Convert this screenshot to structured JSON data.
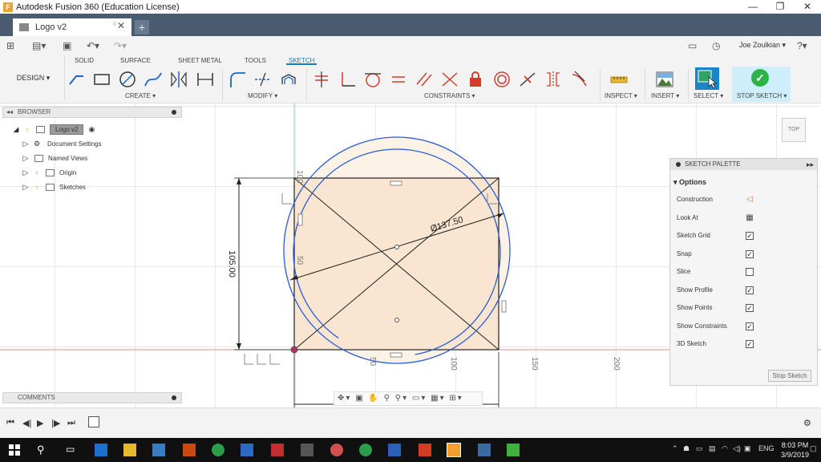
{
  "window": {
    "title": "Autodesk Fusion 360 (Education License)",
    "min": "—",
    "max": "❐",
    "close": "✕"
  },
  "document_tab": {
    "label": "Logo v2",
    "close": "✕",
    "new_tab": "+"
  },
  "user": {
    "name": "Joe Zoulkian ▾"
  },
  "design_button": "DESIGN ▾",
  "ribbon_tabs": [
    "SOLID",
    "SURFACE",
    "SHEET METAL",
    "TOOLS",
    "SKETCH"
  ],
  "active_tab": "SKETCH",
  "ribbon_groups": {
    "create": "CREATE ▾",
    "modify": "MODIFY ▾",
    "constraints": "CONSTRAINTS ▾",
    "inspect": "INSPECT ▾",
    "insert": "INSERT ▾",
    "select": "SELECT ▾",
    "stop_sketch": "STOP SKETCH ▾"
  },
  "browser": {
    "header": "BROWSER",
    "root": "Logo v2",
    "items": [
      "Document Settings",
      "Named Views",
      "Origin",
      "Sketches"
    ]
  },
  "comments": {
    "header": "COMMENTS"
  },
  "sketch_palette": {
    "header": "SKETCH PALETTE",
    "section": "Options",
    "options": [
      {
        "label": "Construction",
        "kind": "icon"
      },
      {
        "label": "Look At",
        "kind": "icon"
      },
      {
        "label": "Sketch Grid",
        "kind": "check",
        "checked": true
      },
      {
        "label": "Snap",
        "kind": "check",
        "checked": true
      },
      {
        "label": "Slice",
        "kind": "check",
        "checked": false
      },
      {
        "label": "Show Profile",
        "kind": "check",
        "checked": true
      },
      {
        "label": "Show Points",
        "kind": "check",
        "checked": true
      },
      {
        "label": "Show Constraints",
        "kind": "check",
        "checked": true
      },
      {
        "label": "3D Sketch",
        "kind": "check",
        "checked": true
      }
    ],
    "stop_button": "Stop Sketch"
  },
  "sketch": {
    "dim_height": "105.00",
    "dim_diameter": "Ø137.50",
    "ruler_labels": [
      "50",
      "100",
      "150",
      "200"
    ],
    "vertical_ruler": [
      "100",
      "50"
    ]
  },
  "viewcube": {
    "label": "TOP"
  },
  "taskbar": {
    "lang": "ENG",
    "time": "8:03 PM",
    "date": "3/9/2019"
  },
  "colors": {
    "accent": "#1a86c8",
    "sketch_line": "#2a5bd8",
    "profile_fill": "#fdf0e2",
    "stop_green": "#2db34a"
  }
}
